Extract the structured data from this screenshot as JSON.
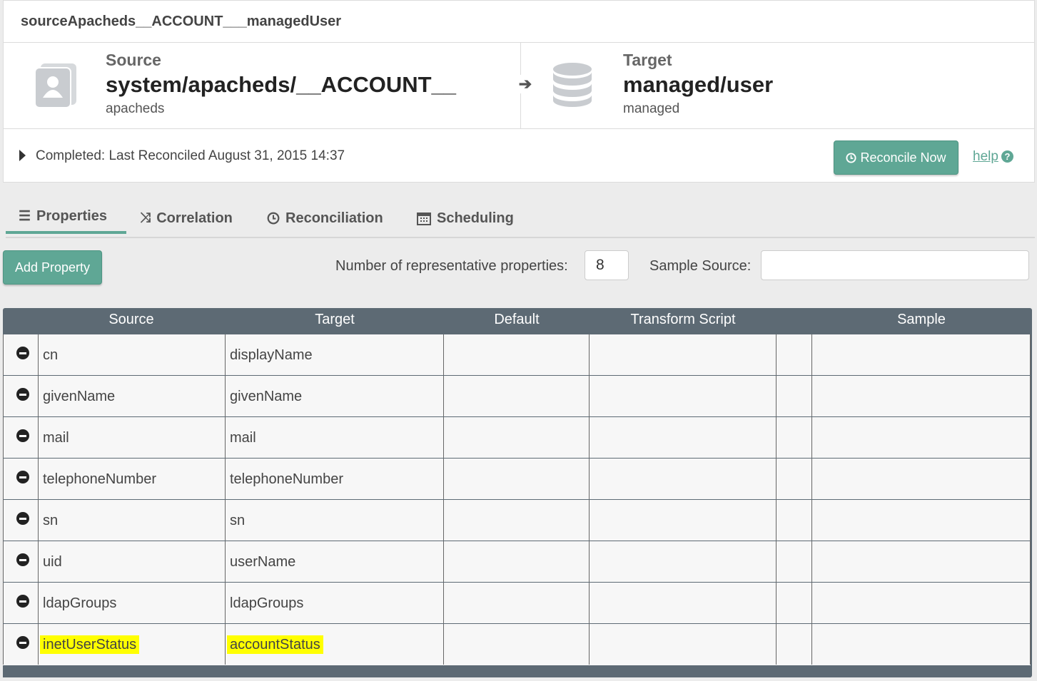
{
  "mapping": {
    "title": "sourceApacheds__ACCOUNT___managedUser"
  },
  "source": {
    "label": "Source",
    "path": "system/apacheds/__ACCOUNT__",
    "name": "apacheds",
    "icon": "user-card-icon"
  },
  "target": {
    "label": "Target",
    "path": "managed/user",
    "name": "managed",
    "icon": "database-icon"
  },
  "status": {
    "text": "Completed: Last Reconciled August 31, 2015 14:37"
  },
  "actions": {
    "reconcile_label": "Reconcile Now",
    "help_label": "help",
    "help_icon": "?"
  },
  "tabs": [
    {
      "label": "Properties",
      "icon": "list-icon",
      "active": true
    },
    {
      "label": "Correlation",
      "icon": "shuffle-icon",
      "active": false
    },
    {
      "label": "Reconciliation",
      "icon": "clock-icon",
      "active": false
    },
    {
      "label": "Scheduling",
      "icon": "calendar-icon",
      "active": false
    }
  ],
  "toolbar": {
    "add_property_label": "Add Property",
    "num_props_label": "Number of representative properties:",
    "num_props_value": "8",
    "sample_source_label": "Sample Source:",
    "sample_source_value": ""
  },
  "grid": {
    "headers": {
      "source": "Source",
      "target": "Target",
      "default": "Default",
      "transform": "Transform Script",
      "sample": "Sample"
    },
    "rows": [
      {
        "source": "cn",
        "target": "displayName"
      },
      {
        "source": "givenName",
        "target": "givenName"
      },
      {
        "source": "mail",
        "target": "mail"
      },
      {
        "source": "telephoneNumber",
        "target": "telephoneNumber"
      },
      {
        "source": "sn",
        "target": "sn"
      },
      {
        "source": "uid",
        "target": "userName"
      },
      {
        "source": "ldapGroups",
        "target": "ldapGroups"
      },
      {
        "source": "inetUserStatus",
        "target": "accountStatus",
        "highlighted": true
      }
    ]
  },
  "colors": {
    "accent": "#5fa795",
    "grid_header": "#5d6a74",
    "highlight": "#ffff00"
  }
}
